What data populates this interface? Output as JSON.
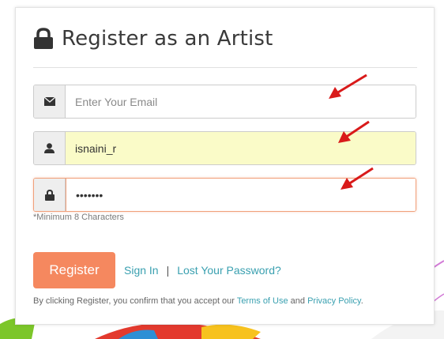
{
  "form": {
    "title": "Register as an Artist",
    "email": {
      "placeholder": "Enter Your Email",
      "value": ""
    },
    "username": {
      "value": "isnaini_r"
    },
    "password": {
      "value": "•••••••"
    },
    "password_hint": "*Minimum 8 Characters"
  },
  "actions": {
    "register_label": "Register",
    "sign_in_label": "Sign In",
    "separator": "|",
    "lost_password_label": "Lost Your Password?"
  },
  "consent": {
    "prefix": "By clicking Register, you confirm that you accept our ",
    "terms_label": "Terms of Use",
    "middle": " and ",
    "privacy_label": "Privacy Policy",
    "suffix": "."
  },
  "icons": {
    "title": "lock-icon",
    "email": "envelope-icon",
    "username": "user-icon",
    "password": "lock-icon",
    "annotation": "red-arrow-icon"
  },
  "colors": {
    "accent": "#f5885f",
    "link": "#3aa0b0",
    "autofill_bg": "#fafbc8",
    "focus_border": "#f0a07a"
  }
}
